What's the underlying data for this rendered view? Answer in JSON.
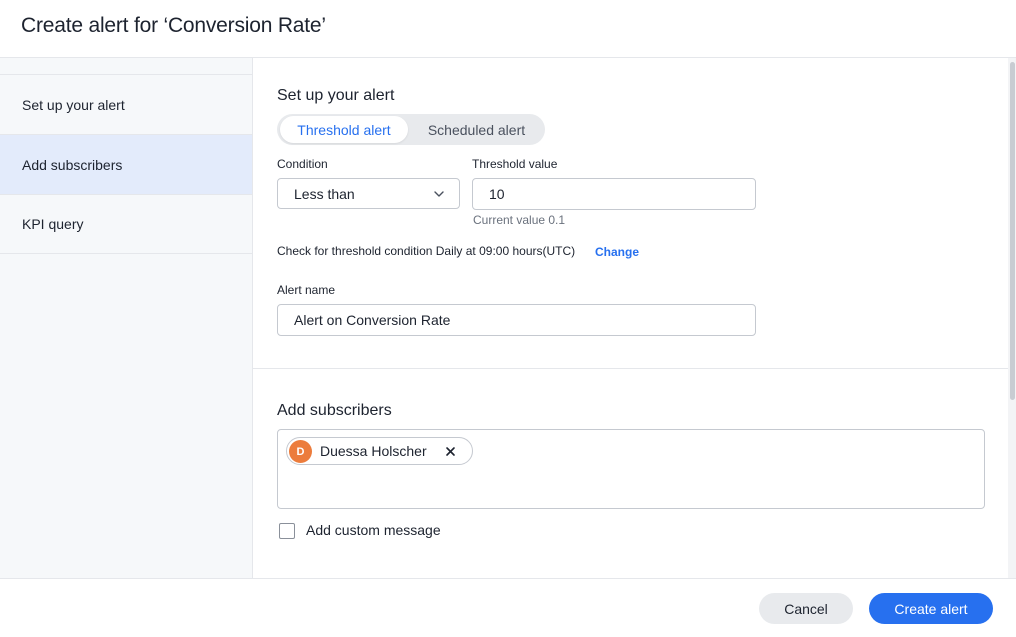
{
  "dialog": {
    "title": "Create alert for ‘Conversion Rate’"
  },
  "sidebar": {
    "items": [
      {
        "label": "Set up your alert"
      },
      {
        "label": "Add subscribers"
      },
      {
        "label": "KPI query"
      }
    ]
  },
  "setup": {
    "section_title": "Set up your alert",
    "alert_types": [
      "Threshold alert",
      "Scheduled alert"
    ],
    "condition_label": "Condition",
    "condition_value": "Less than",
    "threshold_label": "Threshold value",
    "threshold_value": "10",
    "current_value": "Current value 0.1",
    "schedule_text": "Check for threshold condition Daily at 09:00 hours(UTC)",
    "change_link": "Change",
    "alert_name_label": "Alert name",
    "alert_name_value": "Alert on Conversion Rate"
  },
  "subscribers": {
    "section_title": "Add subscribers",
    "list": [
      {
        "initial": "D",
        "name": "Duessa Holscher"
      }
    ],
    "custom_message_label": "Add custom message",
    "custom_message_checked": false
  },
  "footer": {
    "cancel_label": "Cancel",
    "create_label": "Create alert"
  },
  "colors": {
    "accent": "#2770ef",
    "avatar": "#ec7c3c",
    "active_nav": "#e3ebfb"
  },
  "icons": {
    "select": "chevron-down-icon",
    "remove": "close-icon"
  }
}
